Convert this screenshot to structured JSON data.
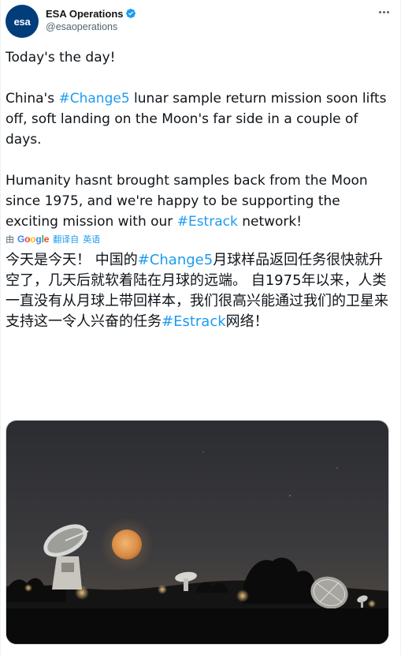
{
  "account": {
    "display_name": "ESA Operations",
    "handle": "@esaoperations",
    "avatar_text": "esa",
    "verified": true
  },
  "tweet": {
    "line1": "Today's the day!",
    "p2_before": "China's ",
    "p2_hashtag": "#Change5",
    "p2_after": " lunar sample return mission soon lifts off, soft landing on the Moon's far side in a couple of days.",
    "p3_before": "Humanity hasnt brought samples back from the Moon since 1975, and we're happy to be supporting the exciting mission with our ",
    "p3_hashtag": "#Estrack",
    "p3_after": " network!"
  },
  "translation_bar": {
    "by": "由",
    "google": "Google",
    "translate_label": "翻译自",
    "language": "英语"
  },
  "translated": {
    "line1": "今天是今天！",
    "p2_before": "中国的",
    "p2_hashtag": "#Change5",
    "p2_after": "月球样品返回任务很快就升空了，几天后就软着陆在月球的远端。",
    "p3_before": "自1975年以来，人类一直没有从月球上带回样本，我们很高兴能通过我们的卫星来支持这一令人兴奋的任务",
    "p3_hashtag": "#Estrack",
    "p3_after": "网络！"
  },
  "colors": {
    "link": "#1d9bf0",
    "text": "#0f1419",
    "secondary": "#536471",
    "verified": "#1d9bf0",
    "avatar_bg": "#003d7a"
  },
  "icons": {
    "verified": "verified-badge-icon",
    "more": "more-options-icon"
  }
}
